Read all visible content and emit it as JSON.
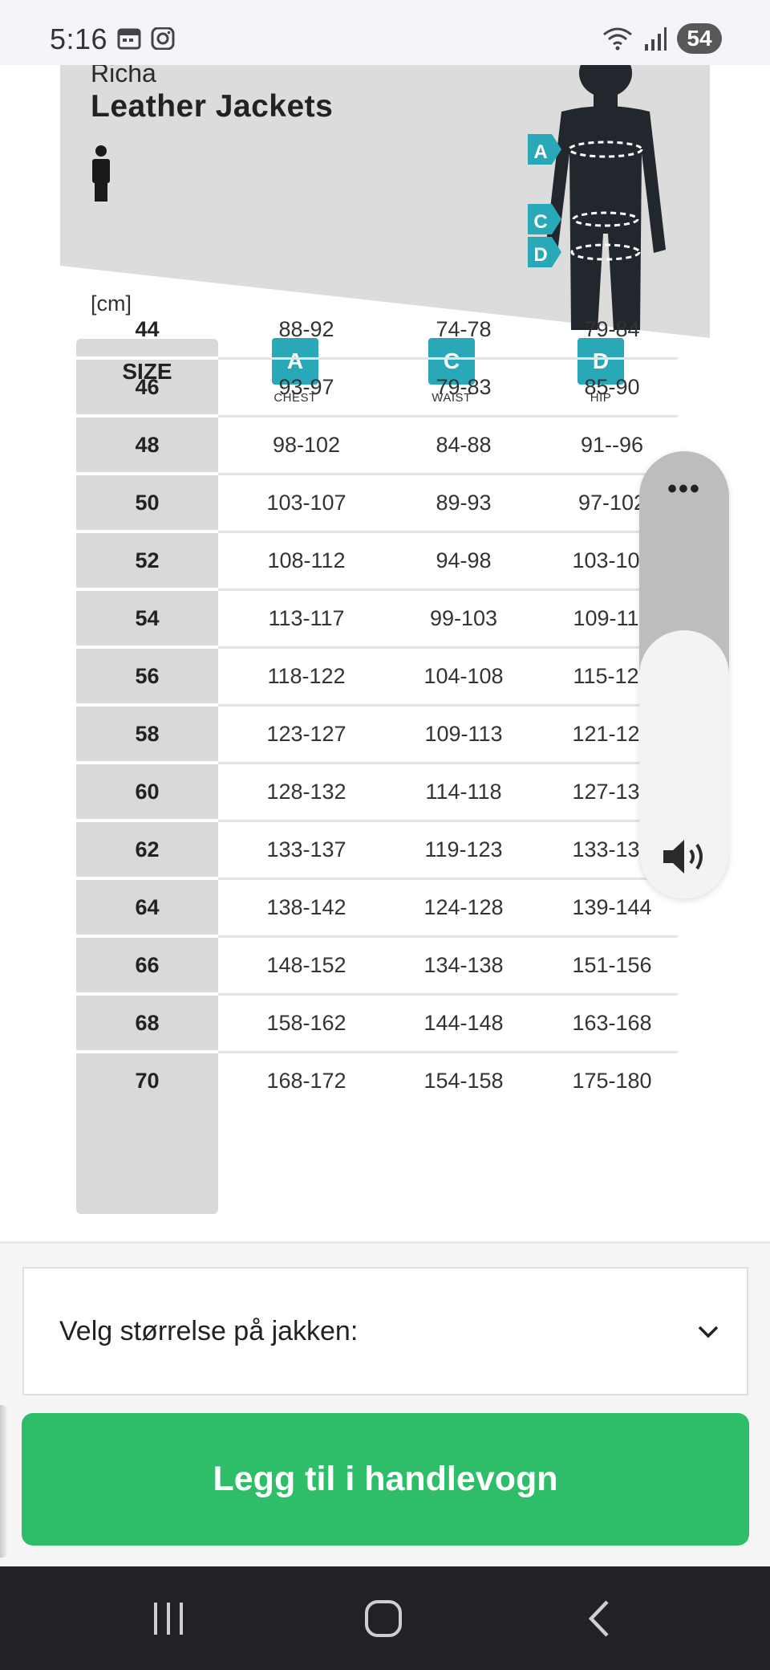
{
  "status_bar": {
    "time": "5:16",
    "battery": "54",
    "icons": [
      "calendar-icon",
      "instagram-icon",
      "wifi-icon",
      "signal-icon"
    ]
  },
  "size_chart": {
    "brand": "Richa",
    "title": "Leather Jackets",
    "unit": "[cm]",
    "gender_icon": "male-figure-icon",
    "figure_markers": [
      "A",
      "C",
      "D"
    ],
    "columns": {
      "size": "SIZE",
      "chest": {
        "letter": "A",
        "label": "CHEST"
      },
      "waist": {
        "letter": "C",
        "label": "WAIST"
      },
      "hip": {
        "letter": "D",
        "label": "HIP"
      }
    },
    "rows": [
      {
        "size": "44",
        "chest": "88-92",
        "waist": "74-78",
        "hip": "79-84"
      },
      {
        "size": "46",
        "chest": "93-97",
        "waist": "79-83",
        "hip": "85-90"
      },
      {
        "size": "48",
        "chest": "98-102",
        "waist": "84-88",
        "hip": "91--96"
      },
      {
        "size": "50",
        "chest": "103-107",
        "waist": "89-93",
        "hip": "97-102"
      },
      {
        "size": "52",
        "chest": "108-112",
        "waist": "94-98",
        "hip": "103-108"
      },
      {
        "size": "54",
        "chest": "113-117",
        "waist": "99-103",
        "hip": "109-114"
      },
      {
        "size": "56",
        "chest": "118-122",
        "waist": "104-108",
        "hip": "115-120"
      },
      {
        "size": "58",
        "chest": "123-127",
        "waist": "109-113",
        "hip": "121-126"
      },
      {
        "size": "60",
        "chest": "128-132",
        "waist": "114-118",
        "hip": "127-132"
      },
      {
        "size": "62",
        "chest": "133-137",
        "waist": "119-123",
        "hip": "133-138"
      },
      {
        "size": "64",
        "chest": "138-142",
        "waist": "124-128",
        "hip": "139-144"
      },
      {
        "size": "66",
        "chest": "148-152",
        "waist": "134-138",
        "hip": "151-156"
      },
      {
        "size": "68",
        "chest": "158-162",
        "waist": "144-148",
        "hip": "163-168"
      },
      {
        "size": "70",
        "chest": "168-172",
        "waist": "154-158",
        "hip": "175-180"
      }
    ]
  },
  "volume_panel": {
    "more_label": "•••",
    "level_fraction": 0.6,
    "icon": "speaker-icon"
  },
  "size_select": {
    "label": "Velg størrelse på jakken:",
    "icon": "chevron-down-icon"
  },
  "add_to_cart": {
    "label": "Legg til i handlevogn",
    "color": "#2ebd68"
  },
  "nav_bar": {
    "icons": [
      "recent-apps-icon",
      "home-icon",
      "back-icon"
    ]
  }
}
